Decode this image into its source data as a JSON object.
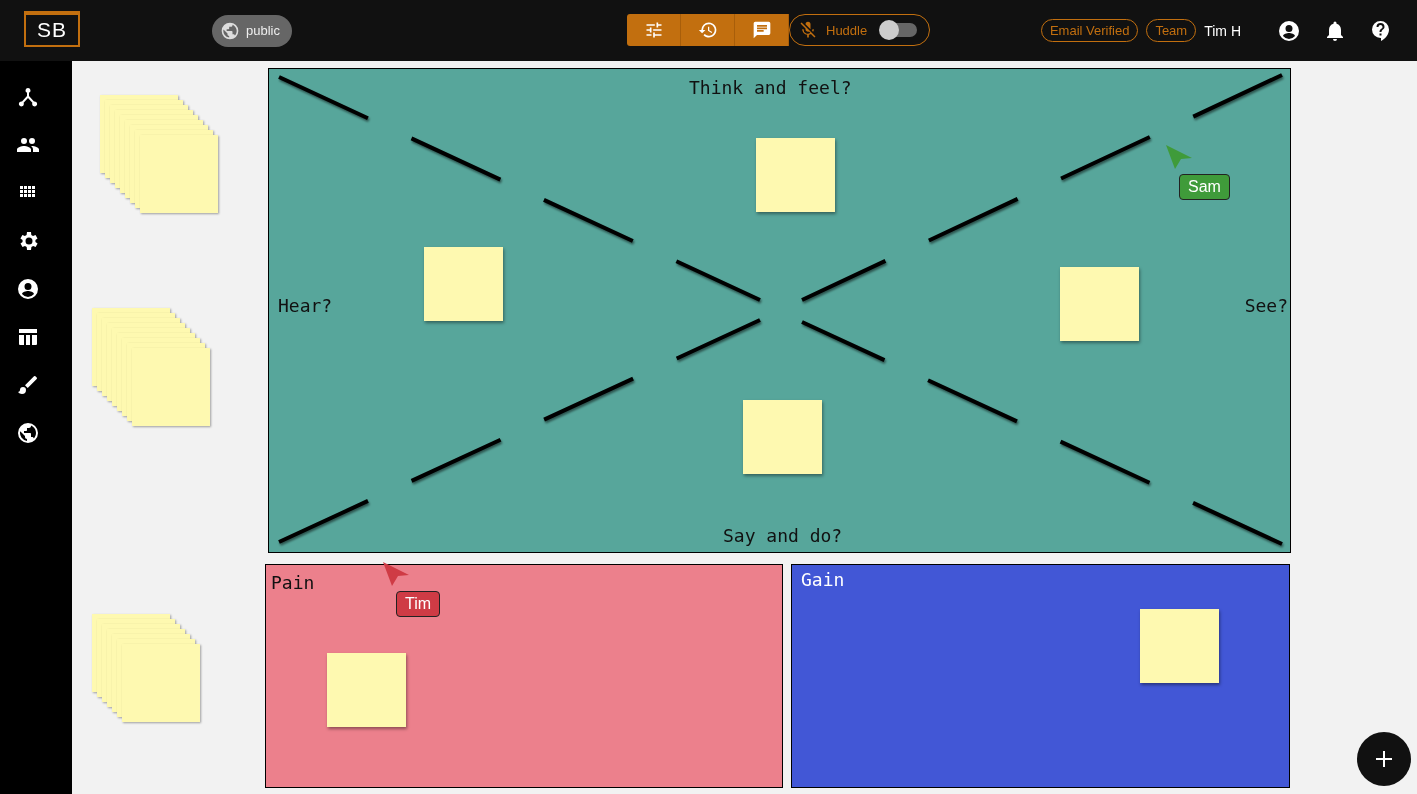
{
  "header": {
    "logo": "SB",
    "visibility": "public",
    "huddle": {
      "label": "Huddle",
      "on": false
    },
    "badges": [
      "Email Verified",
      "Team"
    ],
    "user": "Tim H"
  },
  "board": {
    "top": "Think and feel?",
    "left": "Hear?",
    "right": "See?",
    "bottom": "Say and do?"
  },
  "panels": [
    {
      "title": "Pain",
      "color": "#ec808c"
    },
    {
      "title": "Gain",
      "color": "#4257d6"
    }
  ],
  "cursors": [
    {
      "name": "Sam",
      "color": "#3f9b3a"
    },
    {
      "name": "Tim",
      "color": "#cf3b45"
    }
  ]
}
